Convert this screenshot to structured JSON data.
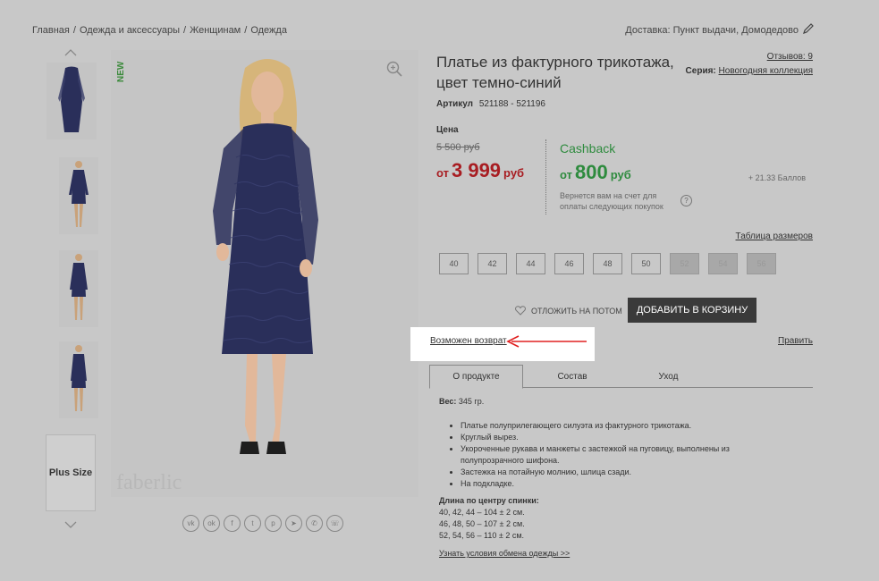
{
  "breadcrumb": [
    "Главная",
    "Одежда и аксессуары",
    "Женщинам",
    "Одежда"
  ],
  "breadcrumb_sep": "/",
  "delivery": "Доставка: Пункт выдачи, Домодедово",
  "gallery": {
    "new_badge": "NEW",
    "plus_size": "Plus Size",
    "watermark": "faberlic"
  },
  "product": {
    "title": "Платье из фактурного трикотажа, цвет темно-синий",
    "reviews": "Отзывов: 9",
    "series_label": "Серия:",
    "series_value": "Новогодняя коллекция",
    "article_label": "Артикул",
    "article_value": "521188 - 521196"
  },
  "price": {
    "label": "Цена",
    "old": "5 500 руб",
    "from": "от",
    "value": "3 999",
    "currency": "руб"
  },
  "cashback": {
    "label": "Cashback",
    "from": "от",
    "value": "800",
    "currency": "руб",
    "points": "+ 21.33 Баллов",
    "note": "Вернется вам на счет для оплаты следующих покупок",
    "help": "?"
  },
  "sizes": {
    "table_link": "Таблица размеров",
    "items": [
      {
        "label": "40",
        "available": true
      },
      {
        "label": "42",
        "available": true
      },
      {
        "label": "44",
        "available": true
      },
      {
        "label": "46",
        "available": true
      },
      {
        "label": "48",
        "available": true
      },
      {
        "label": "50",
        "available": true
      },
      {
        "label": "52",
        "available": false
      },
      {
        "label": "54",
        "available": false
      },
      {
        "label": "56",
        "available": false
      }
    ]
  },
  "actions": {
    "later": "ОТЛОЖИТЬ НА ПОТОМ",
    "add_to_cart": "ДОБАВИТЬ В КОРЗИНУ",
    "return": "Возможен возврат",
    "edit": "Править"
  },
  "tabs": [
    "О продукте",
    "Состав",
    "Уход"
  ],
  "details": {
    "weight_label": "Вес:",
    "weight_value": "345 гр.",
    "features": [
      "Платье полуприлегающего силуэта из фактурного трикотажа.",
      "Круглый вырез.",
      "Укороченные рукава и манжеты с застежкой на пуговицу, выполнены из полупрозрачного шифона.",
      "Застежка на потайную молнию, шлица сзади.",
      "На подкладке."
    ],
    "length_title": "Длина по центру спинки:",
    "lengths": [
      "40, 42, 44 – 104 ± 2 см.",
      "46, 48, 50 – 107 ± 2 см.",
      "52, 54, 56 – 110 ± 2 см."
    ],
    "exchange_link": "Узнать условия обмена одежды >>"
  },
  "social_icons": [
    "vk-icon",
    "odnoklassniki-icon",
    "facebook-icon",
    "twitter-icon",
    "pinterest-icon",
    "telegram-icon",
    "whatsapp-icon",
    "viber-icon"
  ],
  "colors": {
    "price_red": "#a81d22",
    "cashback_green": "#2e8b3e",
    "dress_navy": "#2a2f5a",
    "button_dark": "#3a3a3a",
    "arrow_red": "#e02020"
  }
}
